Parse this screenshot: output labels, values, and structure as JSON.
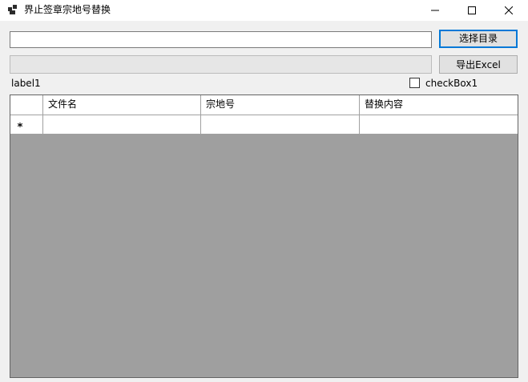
{
  "window": {
    "title": "界止签章宗地号替换",
    "icon": "app-window-icon",
    "controls": [
      "minimize-icon",
      "maximize-icon",
      "close-icon"
    ]
  },
  "path_input": {
    "value": "",
    "placeholder": ""
  },
  "progress": {
    "value": 0
  },
  "buttons": {
    "select_dir": "选择目录",
    "export_excel": "导出Excel"
  },
  "label1": "label1",
  "checkbox1": {
    "label": "checkBox1",
    "checked": false
  },
  "grid": {
    "columns": [
      "文件名",
      "宗地号",
      "替换内容"
    ],
    "new_row_marker": "new-row-asterisk-icon",
    "rows": [
      {
        "cells": [
          "",
          "",
          ""
        ]
      }
    ]
  },
  "colors": {
    "accent": "#0078d7",
    "grid_background": "#9f9f9f",
    "form_background": "#f0f0f0"
  }
}
